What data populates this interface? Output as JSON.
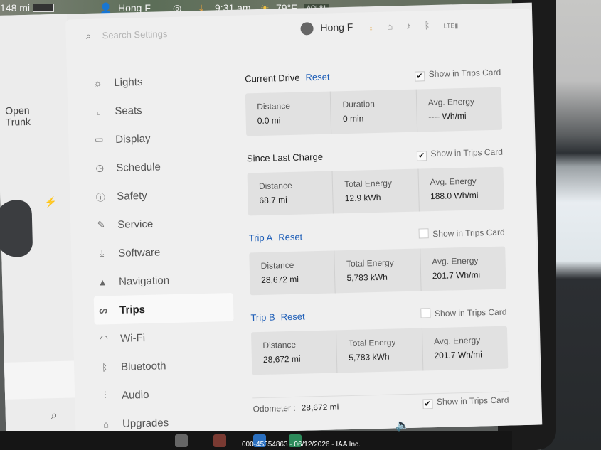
{
  "topbar": {
    "range": "148 mi",
    "driver": "Hong F",
    "time": "9:31 am",
    "temp": "79°F",
    "aqi": "AQI 81"
  },
  "left": {
    "open": "Open",
    "trunk": "Trunk"
  },
  "header": {
    "search_placeholder": "Search Settings",
    "user": "Hong F",
    "icons": [
      "download-icon",
      "home-icon",
      "bell-icon",
      "bluetooth-icon",
      "lte-signal-icon"
    ]
  },
  "menu": [
    {
      "icon": "light-icon",
      "label": "Lights"
    },
    {
      "icon": "seat-icon",
      "label": "Seats"
    },
    {
      "icon": "display-icon",
      "label": "Display"
    },
    {
      "icon": "clock-icon",
      "label": "Schedule"
    },
    {
      "icon": "safety-icon",
      "label": "Safety"
    },
    {
      "icon": "wrench-icon",
      "label": "Service"
    },
    {
      "icon": "download-icon",
      "label": "Software"
    },
    {
      "icon": "navigation-icon",
      "label": "Navigation"
    },
    {
      "icon": "trips-icon",
      "label": "Trips"
    },
    {
      "icon": "wifi-icon",
      "label": "Wi-Fi"
    },
    {
      "icon": "bluetooth-icon",
      "label": "Bluetooth"
    },
    {
      "icon": "audio-icon",
      "label": "Audio"
    },
    {
      "icon": "bag-icon",
      "label": "Upgrades"
    }
  ],
  "current": {
    "title": "Current Drive",
    "reset": "Reset",
    "show": "Show in Trips Card",
    "distance_label": "Distance",
    "distance": "0.0  mi",
    "duration_label": "Duration",
    "duration": "0  min",
    "avg_label": "Avg. Energy",
    "avg": "----  Wh/mi"
  },
  "since": {
    "title": "Since Last Charge",
    "show": "Show in Trips Card",
    "distance_label": "Distance",
    "distance": "68.7  mi",
    "energy_label": "Total Energy",
    "energy": "12.9  kWh",
    "avg_label": "Avg. Energy",
    "avg": "188.0  Wh/mi"
  },
  "tripa": {
    "title": "Trip A",
    "reset": "Reset",
    "show": "Show in Trips Card",
    "distance_label": "Distance",
    "distance": "28,672  mi",
    "energy_label": "Total Energy",
    "energy": "5,783  kWh",
    "avg_label": "Avg. Energy",
    "avg": "201.7  Wh/mi"
  },
  "tripb": {
    "title": "Trip B",
    "reset": "Reset",
    "show": "Show in Trips Card",
    "distance_label": "Distance",
    "distance": "28,672  mi",
    "energy_label": "Total Energy",
    "energy": "5,783  kWh",
    "avg_label": "Avg. Energy",
    "avg": "201.7  Wh/mi"
  },
  "odometer": {
    "label": "Odometer :",
    "value": "28,672  mi",
    "show": "Show in Trips Card"
  },
  "watermark": "000-45354863 - 06/12/2026 - IAA Inc."
}
